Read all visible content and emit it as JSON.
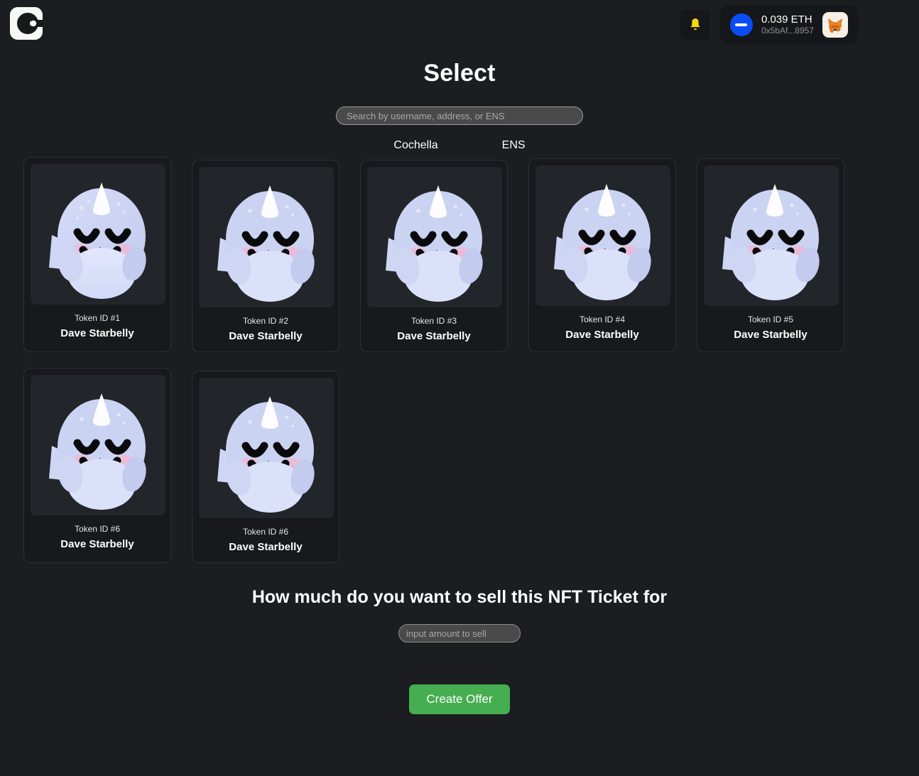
{
  "header": {
    "logo_icon": "cochella-logo-icon",
    "bell_icon": "bell-icon",
    "wallet": {
      "chain_icon": "ethereum-chain-icon",
      "balance": "0.039 ETH",
      "address": "0x5bAf...8957",
      "wallet_provider_icon": "metamask-fox-icon"
    }
  },
  "page": {
    "title": "Select"
  },
  "search": {
    "value": "",
    "placeholder": "Search by username, address, or ENS"
  },
  "sub_labels": [
    {
      "label": "Cochella"
    },
    {
      "label": "ENS"
    }
  ],
  "tokens": [
    {
      "token_id": "Token ID #1",
      "name": "Dave Starbelly",
      "art_icon": "narwhal-nft-icon"
    },
    {
      "token_id": "Token ID #2",
      "name": "Dave Starbelly",
      "art_icon": "narwhal-nft-icon"
    },
    {
      "token_id": "Token ID #3",
      "name": "Dave Starbelly",
      "art_icon": "narwhal-nft-icon"
    },
    {
      "token_id": "Token ID #4",
      "name": "Dave Starbelly",
      "art_icon": "narwhal-nft-icon"
    },
    {
      "token_id": "Token ID #5",
      "name": "Dave Starbelly",
      "art_icon": "narwhal-nft-icon"
    },
    {
      "token_id": "Token ID #6",
      "name": "Dave Starbelly",
      "art_icon": "narwhal-nft-icon"
    },
    {
      "token_id": "Token ID #6",
      "name": "Dave Starbelly",
      "art_icon": "narwhal-nft-icon"
    }
  ],
  "sell": {
    "heading": "How much do you want to sell this NFT Ticket for",
    "amount_value": "",
    "amount_placeholder": "input amount to sell",
    "cta_label": "Create Offer"
  },
  "colors": {
    "page_background": "#1b1d21",
    "card_background": "#17191d",
    "card_border": "#2c2f35",
    "thumb_background": "#22252a",
    "accent_green": "#45ae50",
    "chain_blue": "#0b4df5",
    "bell_yellow": "#f5d90a",
    "input_background": "#4a4a4a",
    "nft_body": "#cbd2f2",
    "nft_belly": "#dce1fa",
    "nft_cheek": "#f0b6d4"
  }
}
